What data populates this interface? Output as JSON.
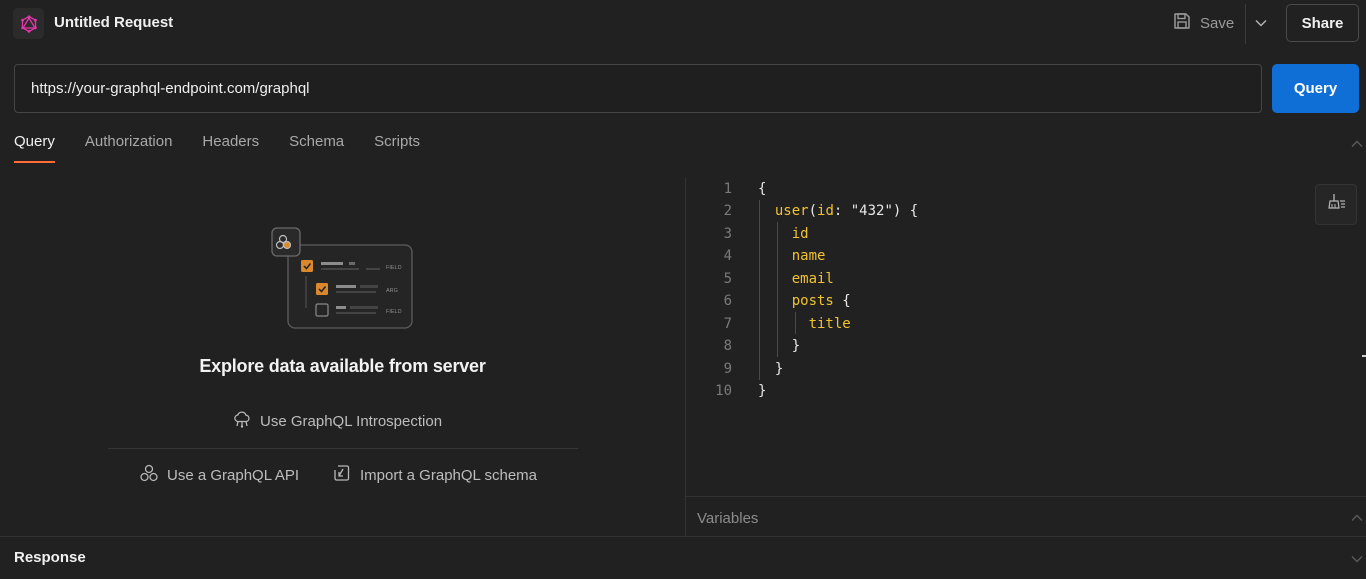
{
  "header": {
    "title": "Untitled Request",
    "save_label": "Save",
    "share_label": "Share"
  },
  "url_bar": {
    "value": "https://your-graphql-endpoint.com/graphql",
    "query_button": "Query"
  },
  "tabs": [
    {
      "label": "Query",
      "active": true
    },
    {
      "label": "Authorization",
      "active": false
    },
    {
      "label": "Headers",
      "active": false
    },
    {
      "label": "Schema",
      "active": false
    },
    {
      "label": "Scripts",
      "active": false
    }
  ],
  "empty_state": {
    "illustration_labels": [
      "FIELD",
      "ARG",
      "FIELD"
    ],
    "title": "Explore data available from server",
    "introspection_link": "Use GraphQL Introspection",
    "api_link": "Use a GraphQL API",
    "schema_link": "Import a GraphQL schema"
  },
  "editor": {
    "line_numbers": [
      "1",
      "2",
      "3",
      "4",
      "5",
      "6",
      "7",
      "8",
      "9",
      "10"
    ]
  },
  "variables_label": "Variables",
  "response_label": "Response",
  "colors": {
    "accent_tab": "#ff6c37",
    "primary_button": "#0f6fd6",
    "code_keyword": "#f1c232",
    "background": "#212121"
  }
}
